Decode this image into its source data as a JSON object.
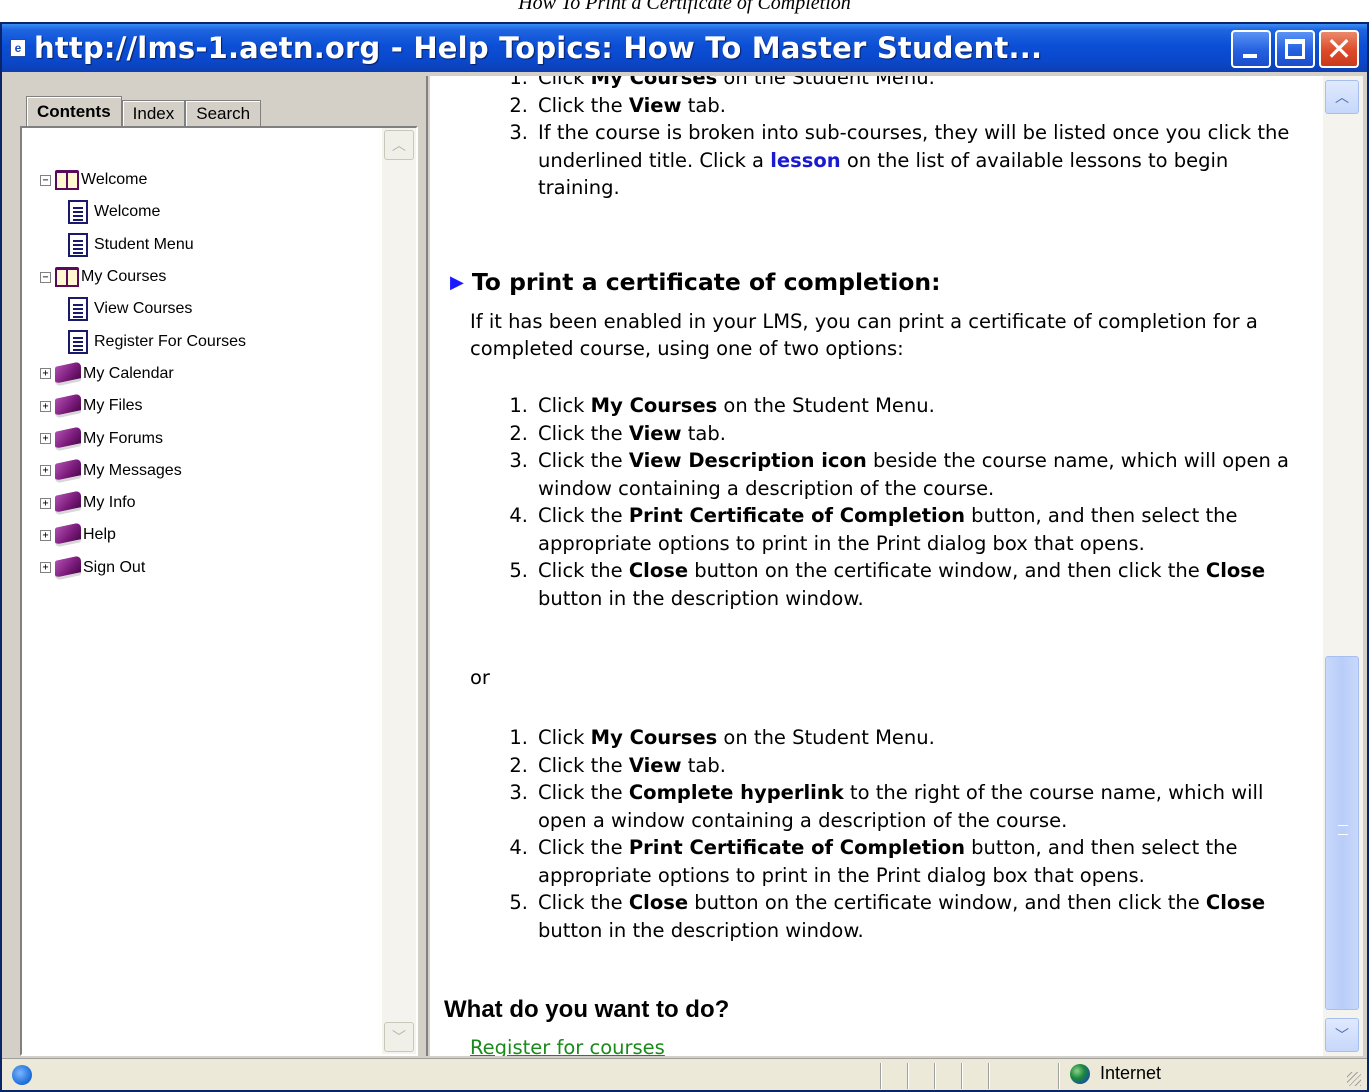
{
  "caption": "How To Print a Certificate of Completion",
  "window": {
    "title": "http://lms-1.aetn.org - Help Topics: How To Master Student...",
    "icon": "ie-page-icon"
  },
  "tabs": [
    {
      "label": "Contents",
      "active": true
    },
    {
      "label": "Index",
      "active": false
    },
    {
      "label": "Search",
      "active": false
    }
  ],
  "tree": [
    {
      "label": "Welcome",
      "type": "book-open",
      "expander": "−",
      "level": 0
    },
    {
      "label": "Welcome",
      "type": "page",
      "level": 1
    },
    {
      "label": "Student Menu",
      "type": "page",
      "level": 1
    },
    {
      "label": "My Courses",
      "type": "book-open",
      "expander": "−",
      "level": 0
    },
    {
      "label": "View Courses",
      "type": "page",
      "level": 1
    },
    {
      "label": "Register For Courses",
      "type": "page",
      "level": 1
    },
    {
      "label": "My Calendar",
      "type": "book-closed",
      "expander": "+",
      "level": 0
    },
    {
      "label": "My Files",
      "type": "book-closed",
      "expander": "+",
      "level": 0
    },
    {
      "label": "My Forums",
      "type": "book-closed",
      "expander": "+",
      "level": 0
    },
    {
      "label": "My Messages",
      "type": "book-closed",
      "expander": "+",
      "level": 0
    },
    {
      "label": "My Info",
      "type": "book-closed",
      "expander": "+",
      "level": 0
    },
    {
      "label": "Help",
      "type": "book-closed",
      "expander": "+",
      "level": 0
    },
    {
      "label": "Sign Out",
      "type": "book-closed",
      "expander": "+",
      "level": 0
    }
  ],
  "content": {
    "top_list": [
      {
        "num": "1.",
        "parts": [
          [
            "t",
            "Click "
          ],
          [
            "b",
            "My Courses"
          ],
          [
            "t",
            " on the Student Menu."
          ]
        ]
      },
      {
        "num": "2.",
        "parts": [
          [
            "t",
            "Click the "
          ],
          [
            "b",
            "View"
          ],
          [
            "t",
            " tab."
          ]
        ]
      },
      {
        "num": "3.",
        "parts": [
          [
            "t",
            "If the course is broken into sub-courses, they will be listed once you click the underlined title. Click a "
          ],
          [
            "a",
            "lesson"
          ],
          [
            "t",
            " on the list of available lessons to begin training."
          ]
        ]
      }
    ],
    "heading": "To print a certificate of completion:",
    "intro": "If it has been enabled in your LMS, you can print a certificate of completion for a completed course, using one of two options:",
    "list1": [
      {
        "num": "1.",
        "parts": [
          [
            "t",
            "Click "
          ],
          [
            "b",
            "My Courses"
          ],
          [
            "t",
            " on the Student Menu."
          ]
        ]
      },
      {
        "num": "2.",
        "parts": [
          [
            "t",
            "Click the "
          ],
          [
            "b",
            "View"
          ],
          [
            "t",
            " tab."
          ]
        ]
      },
      {
        "num": "3.",
        "parts": [
          [
            "t",
            "Click the "
          ],
          [
            "b",
            "View Description icon"
          ],
          [
            "t",
            " beside the course name, which will open a window containing a description of the course."
          ]
        ]
      },
      {
        "num": "4.",
        "parts": [
          [
            "t",
            "Click the "
          ],
          [
            "b",
            "Print Certificate of Completion"
          ],
          [
            "t",
            " button, and then select the appropriate options to print in the Print dialog box that opens."
          ]
        ]
      },
      {
        "num": "5.",
        "parts": [
          [
            "t",
            "Click the "
          ],
          [
            "b",
            "Close"
          ],
          [
            "t",
            " button on the certificate window, and then click the "
          ],
          [
            "b",
            "Close"
          ],
          [
            "t",
            " button in the description window."
          ]
        ]
      }
    ],
    "or": "or",
    "list2": [
      {
        "num": "1.",
        "parts": [
          [
            "t",
            "Click "
          ],
          [
            "b",
            "My Courses"
          ],
          [
            "t",
            " on the Student Menu."
          ]
        ]
      },
      {
        "num": "2.",
        "parts": [
          [
            "t",
            "Click the "
          ],
          [
            "b",
            "View"
          ],
          [
            "t",
            " tab."
          ]
        ]
      },
      {
        "num": "3.",
        "parts": [
          [
            "t",
            "Click the "
          ],
          [
            "b",
            "Complete hyperlink"
          ],
          [
            "t",
            " to the right of the course name, which will open a window containing a description of the course."
          ]
        ]
      },
      {
        "num": "4.",
        "parts": [
          [
            "t",
            "Click the "
          ],
          [
            "b",
            "Print Certificate of Completion"
          ],
          [
            "t",
            " button, and then select the appropriate options to print in the Print dialog box that opens."
          ]
        ]
      },
      {
        "num": "5.",
        "parts": [
          [
            "t",
            "Click the "
          ],
          [
            "b",
            "Close"
          ],
          [
            "t",
            " button on the certificate window, and then click the "
          ],
          [
            "b",
            "Close"
          ],
          [
            "t",
            " button in the description window."
          ]
        ]
      }
    ],
    "what_heading": "What do you want to do?",
    "link": "Register for courses"
  },
  "status": {
    "zone": "Internet"
  }
}
